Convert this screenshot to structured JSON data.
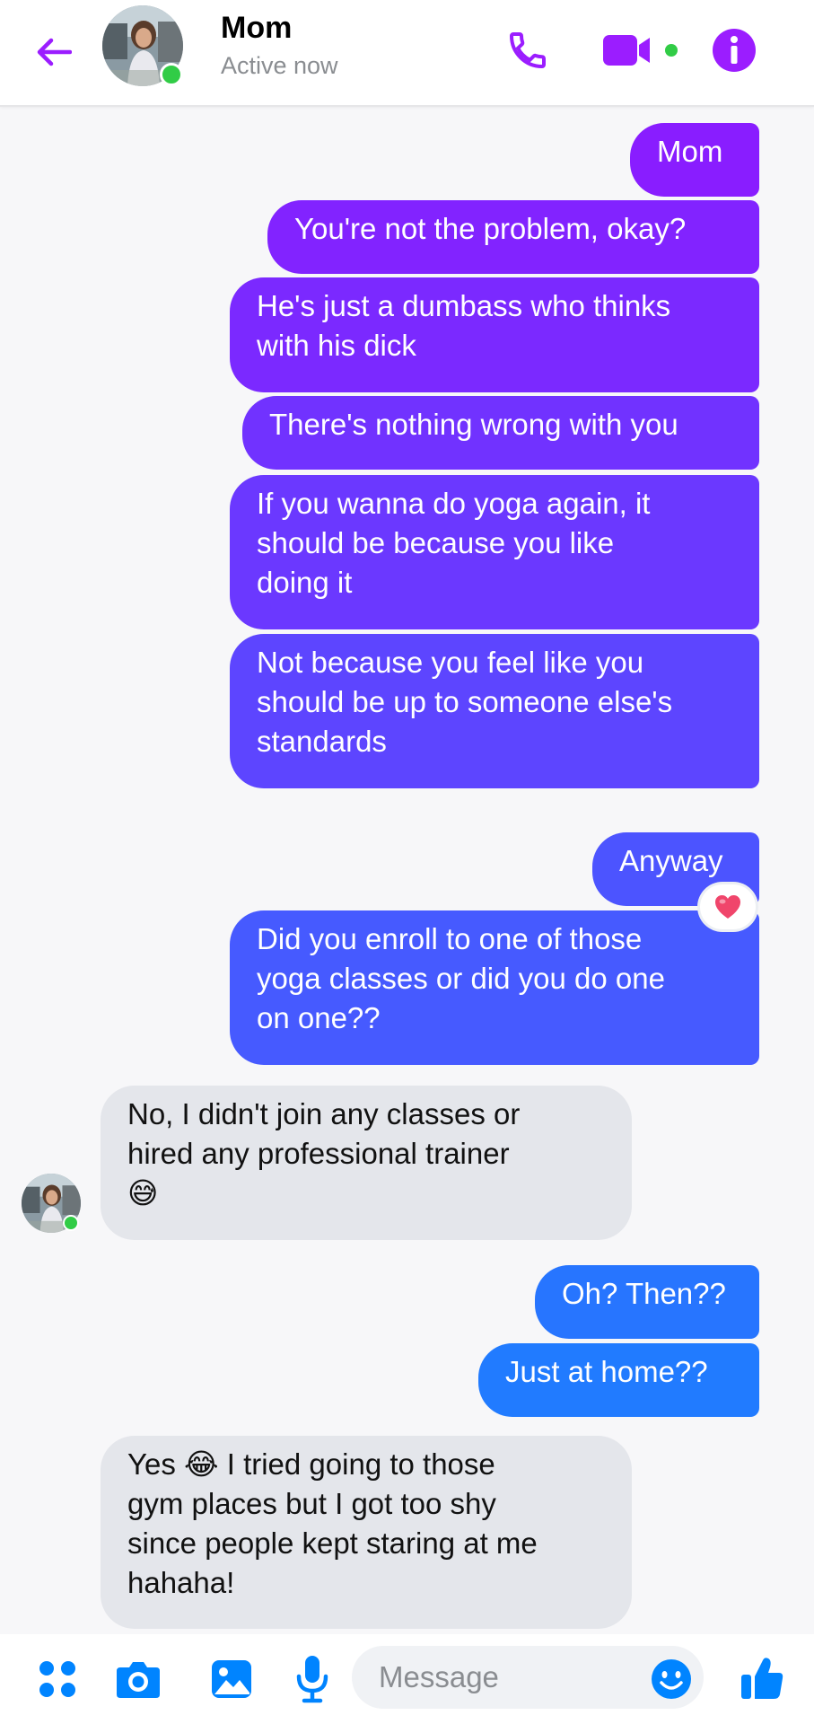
{
  "header": {
    "contact_name": "Mom",
    "status_text": "Active now"
  },
  "colors": {
    "accent": "#9b1dff",
    "online": "#31cc46",
    "incoming_bubble": "#e4e6eb",
    "outgoing_gradient_top": "#8a1cff",
    "outgoing_gradient_bottom": "#1f7dff"
  },
  "messages": [
    {
      "side": "out",
      "text": "Mom"
    },
    {
      "side": "out",
      "text": "You're not the problem, okay?"
    },
    {
      "side": "out",
      "text": "He's just a dumbass who thinks\nwith his dick"
    },
    {
      "side": "out",
      "text": "There's nothing wrong with you"
    },
    {
      "side": "out",
      "text": "If you wanna do yoga again, it\nshould be because you like\ndoing it"
    },
    {
      "side": "out",
      "text": "Not because you feel like you\nshould be up to someone else's\nstandards",
      "reaction": "heart"
    },
    {
      "side": "out",
      "text": "Anyway"
    },
    {
      "side": "out",
      "text": "Did you enroll to one of those\nyoga classes or did you do one\non one??"
    },
    {
      "side": "in",
      "text": "No, I didn't join any classes or\nhired any professional trainer\n😅"
    },
    {
      "side": "out",
      "text": "Oh? Then??"
    },
    {
      "side": "out",
      "text": "Just at home??"
    },
    {
      "side": "in",
      "text": "Yes 😂 I tried going to those\ngym places but I got too shy\nsince people kept staring at me\nhahaha!"
    }
  ],
  "composer": {
    "placeholder": "Message"
  },
  "icons": {
    "back": "back-arrow-icon",
    "call": "phone-icon",
    "video": "video-camera-icon",
    "info": "info-icon",
    "menu": "four-dots-icon",
    "camera": "camera-icon",
    "gallery": "image-icon",
    "mic": "microphone-icon",
    "emoji": "smiley-icon",
    "like": "thumbs-up-icon",
    "reaction": "heart-icon"
  }
}
